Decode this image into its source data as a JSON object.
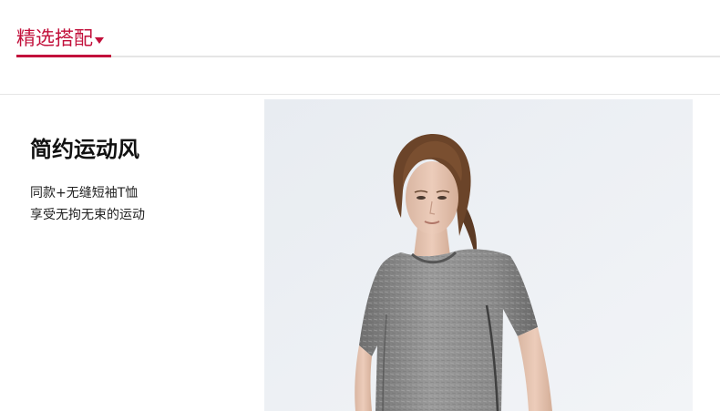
{
  "section": {
    "tab_label": "精选搭配",
    "caret_icon": "caret-down-icon",
    "accent_color": "#c2103b"
  },
  "feature": {
    "title": "简约运动风",
    "desc_line1": "同款+无缝短袖T恤",
    "desc_line2": "享受无拘无束的运动"
  },
  "photo": {
    "subject": "model-wearing-gray-tshirt-photo",
    "background_color": "#eceff3",
    "shirt_color": "#8d8d8d"
  }
}
